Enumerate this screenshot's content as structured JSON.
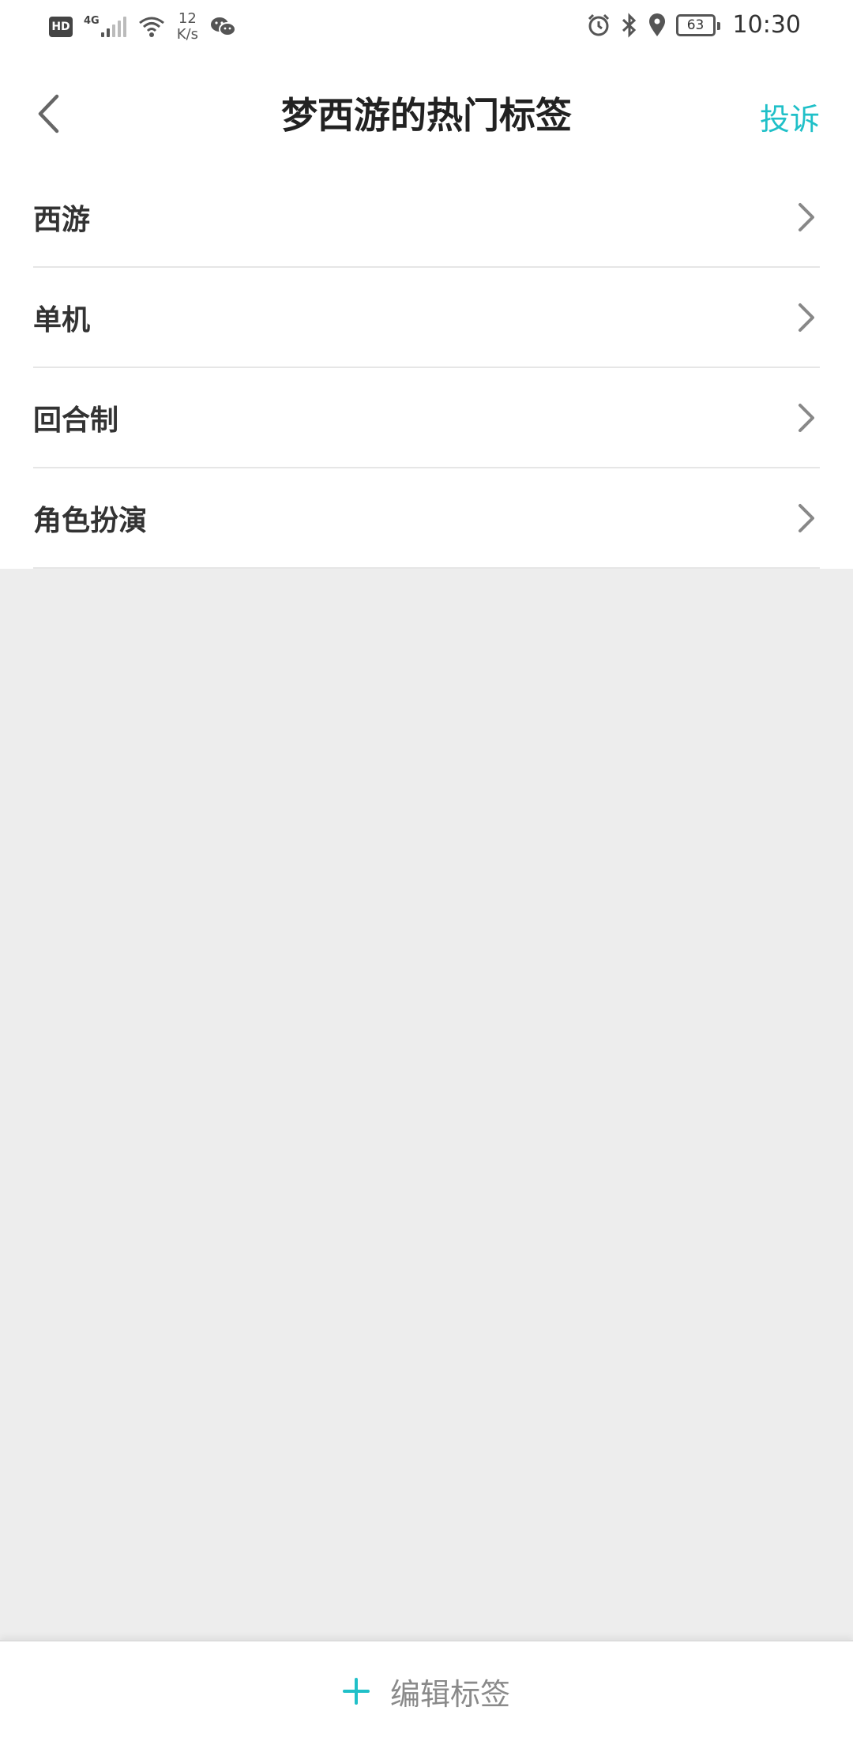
{
  "status_bar": {
    "hd": "HD",
    "network": "4G",
    "speed_value": "12",
    "speed_unit": "K/s",
    "battery": "63",
    "time": "10:30"
  },
  "nav": {
    "title": "梦西游的热门标签",
    "report": "投诉"
  },
  "tags": [
    {
      "label": "西游"
    },
    {
      "label": "单机"
    },
    {
      "label": "回合制"
    },
    {
      "label": "角色扮演"
    }
  ],
  "bottom": {
    "edit_label": "编辑标签"
  },
  "colors": {
    "accent": "#20c0c8",
    "background": "#ededed",
    "surface": "#ffffff"
  }
}
